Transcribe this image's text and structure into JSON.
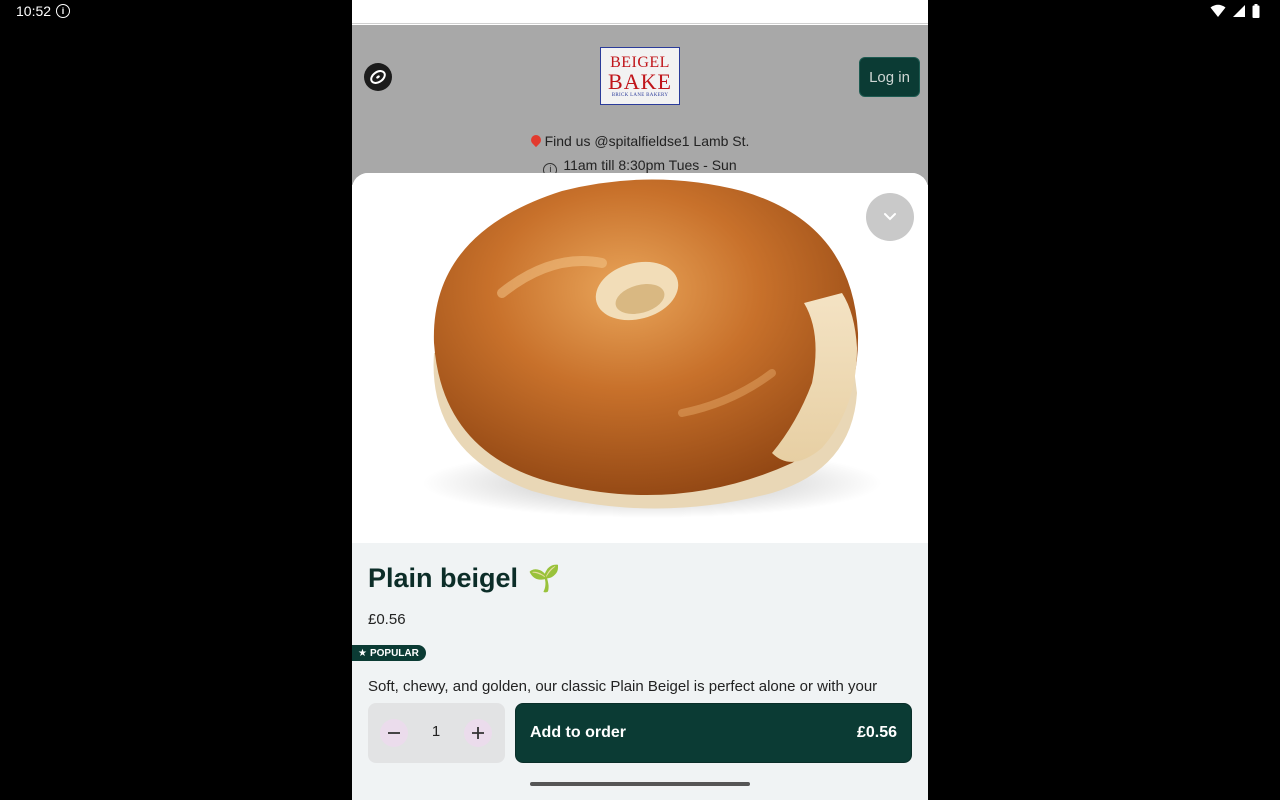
{
  "status_bar": {
    "time": "10:52"
  },
  "header": {
    "brand_line1": "BEIGEL",
    "brand_line2": "BAKE",
    "brand_line3": "BRICK LANE BAKERY",
    "login_label": "Log in",
    "location_text": "Find us @spitalfieldse1 Lamb St.",
    "hours_text": "11am till 8:30pm Tues - Sun"
  },
  "product": {
    "name": "Plain beigel",
    "name_emoji": "🌱",
    "price": "£0.56",
    "badge": "POPULAR",
    "description": "Soft, chewy, and golden, our classic Plain Beigel is perfect alone or with your"
  },
  "order": {
    "quantity": "1",
    "add_label": "Add to order",
    "total": "£0.56"
  },
  "colors": {
    "primary": "#0b3b34",
    "sheet_bg": "#f0f3f4",
    "header_overlay": "#a8a8a8",
    "brand_red": "#c0151a",
    "brand_blue": "#2a3b9a"
  }
}
